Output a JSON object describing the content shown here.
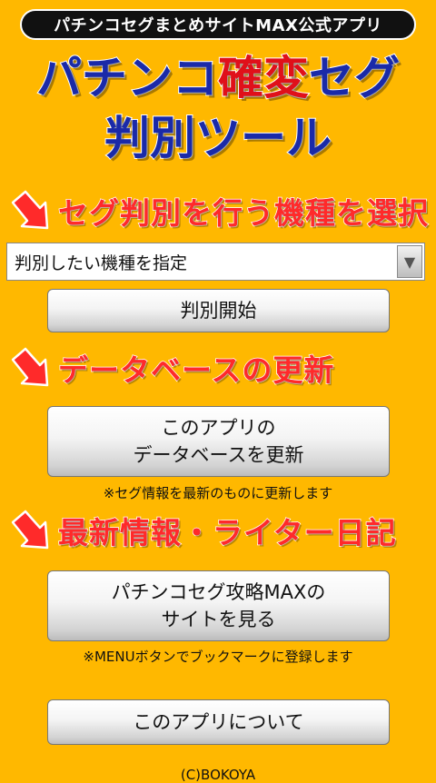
{
  "header": {
    "banner": "パチンコセグまとめサイトMAX公式アプリ",
    "title_line1_a": "パチンコ",
    "title_line1_b": "確変",
    "title_line1_c": "セグ",
    "title_line2": "判別ツール"
  },
  "sections": {
    "select_machine": "セグ判別を行う機種を選択",
    "database_update": "データベースの更新",
    "latest_info": "最新情報・ライター日記"
  },
  "machine_select": {
    "value": "判別したい機種を指定"
  },
  "buttons": {
    "start": "判別開始",
    "update_line1": "このアプリの",
    "update_line2": "データベースを更新",
    "site_line1": "パチンコセグ攻略MAXの",
    "site_line2": "サイトを見る",
    "about": "このアプリについて"
  },
  "notes": {
    "update": "※セグ情報を最新のものに更新します",
    "bookmark": "※MENUボタンでブックマークに登録します"
  },
  "footer": {
    "copyright": "(C)BOKOYA"
  },
  "colors": {
    "background": "#FFB800",
    "title_blue": "#1a2aa8",
    "title_red": "#e0101a",
    "section_red": "#ff2a2a"
  }
}
